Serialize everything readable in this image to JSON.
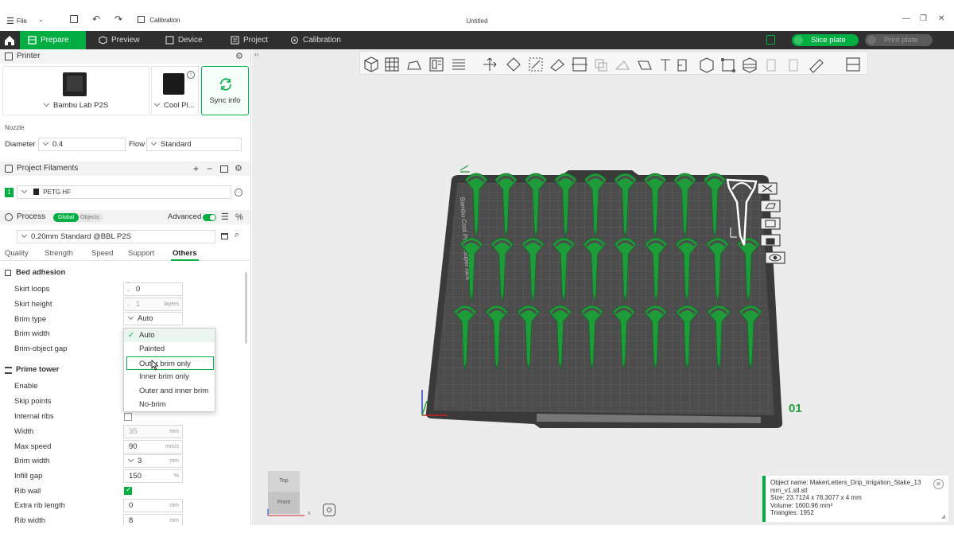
{
  "titlebar": {
    "file_label": "File",
    "calibration_label": "Calibration",
    "document_title": "Untitled"
  },
  "nav": {
    "tabs": [
      {
        "label": "Prepare"
      },
      {
        "label": "Preview"
      },
      {
        "label": "Device"
      },
      {
        "label": "Project"
      },
      {
        "label": "Calibration"
      }
    ],
    "slice_plate": "Slice plate",
    "print_plate": "Print plate"
  },
  "printer": {
    "header": "Printer",
    "printer_name": "Bambu Lab P2S",
    "plate_name": "Cool Pl...",
    "sync_label": "Sync info",
    "nozzle_label": "Nozzle",
    "diameter_label": "Diameter",
    "diameter_value": "0.4",
    "flow_label": "Flow",
    "flow_value": "Standard"
  },
  "filaments": {
    "header": "Project Filaments",
    "slot_number": "1",
    "filament_name": "PETG HF"
  },
  "process": {
    "header": "Process",
    "global_label": "Global",
    "objects_label": "Objects",
    "advanced_label": "Advanced",
    "preset": "0.20mm Standard @BBL P2S",
    "tabs": [
      "Quality",
      "Strength",
      "Speed",
      "Support",
      "Others"
    ],
    "active_tab": "Others"
  },
  "bed_adhesion": {
    "header": "Bed adhesion",
    "skirt_loops_label": "Skirt loops",
    "skirt_loops": "0",
    "skirt_height_label": "Skirt height",
    "skirt_height": "1",
    "skirt_height_unit": "layers",
    "brim_type_label": "Brim type",
    "brim_type": "Auto",
    "brim_width_label": "Brim width",
    "brim_gap_label": "Brim-object gap"
  },
  "brim_dropdown": {
    "options": [
      "Auto",
      "Painted",
      "Outer brim only",
      "Inner brim only",
      "Outer and inner brim",
      "No-brim"
    ]
  },
  "prime_tower": {
    "header": "Prime tower",
    "enable_label": "Enable",
    "skip_points_label": "Skip points",
    "internal_ribs_label": "Internal ribs",
    "width_label": "Width",
    "width": "35",
    "width_unit": "mm",
    "max_speed_label": "Max speed",
    "max_speed": "90",
    "max_speed_unit": "mm/s",
    "brim_width_label": "Brim width",
    "brim_width": "3",
    "brim_width_unit": "mm",
    "infill_gap_label": "Infill gap",
    "infill_gap": "150",
    "infill_gap_unit": "%",
    "rib_wall_label": "Rib wall",
    "extra_rib_label": "Extra rib length",
    "extra_rib": "0",
    "extra_rib_unit": "mm",
    "rib_width_label": "Rib width",
    "rib_width": "8",
    "rib_width_unit": "mm"
  },
  "viewport": {
    "plate_number": "01",
    "plate_side_text": "Bambu Cool Plate SuperTack",
    "cube_top": "Top",
    "cube_front": "Front",
    "axis_x": "x"
  },
  "object_info": {
    "line1": "Object name: MakerLetters_Drip_Irrigation_Stake_13",
    "line2": "mm_v1.stl.stl",
    "line3": "Size: 23.7124 x 78.3077 x 4 mm",
    "line4": "Volume: 1600.96 mm³",
    "line5": "Triangles: 1952"
  },
  "colors": {
    "accent": "#00ae42",
    "nav_bg": "#2f2f2f",
    "model_green": "#1f9c3a",
    "plate": "#4a4a4a"
  }
}
